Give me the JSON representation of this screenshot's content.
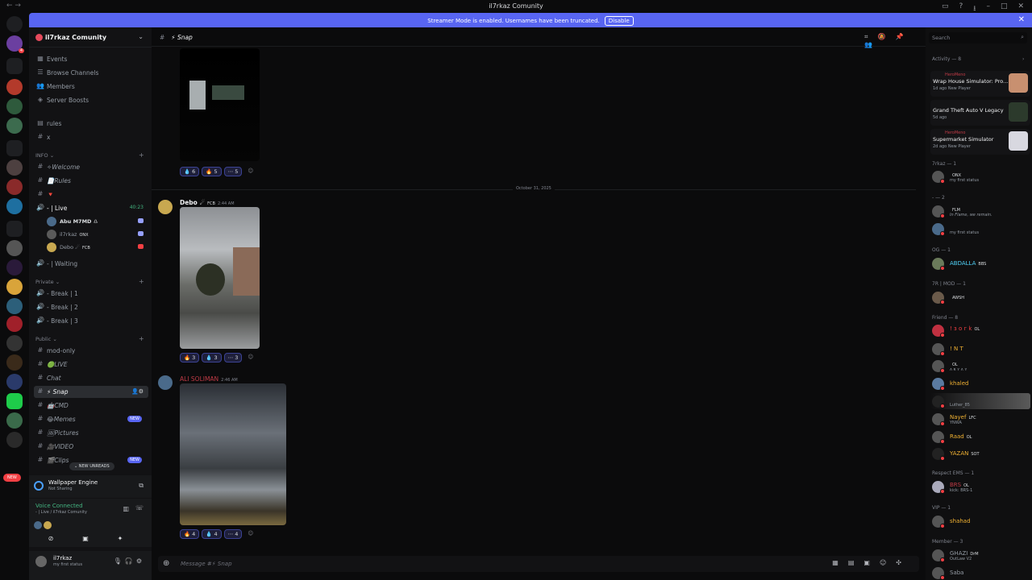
{
  "window": {
    "title": "il7rkaz Comunity"
  },
  "banner": {
    "text": "Streamer Mode is enabled. Usernames have been truncated.",
    "button": "Disable"
  },
  "server": {
    "name": "il7rkaz Comunity"
  },
  "nav": [
    {
      "label": "Events",
      "icon": "calendar-icon"
    },
    {
      "label": "Browse Channels",
      "icon": "browse-channels-icon"
    },
    {
      "label": "Members",
      "icon": "members-icon"
    },
    {
      "label": "Server Boosts",
      "icon": "boost-icon"
    }
  ],
  "top_channels": [
    "rules",
    "x"
  ],
  "categories": {
    "info": "INFO",
    "private": "Private",
    "public": "Public"
  },
  "info_channels": [
    "✧Welcome",
    "📄Rules",
    "🔻"
  ],
  "live_channel": {
    "label": "- | Live",
    "timer": "40:23"
  },
  "voice_users": [
    {
      "name": "Abu M7MD ♎",
      "tag": ""
    },
    {
      "name": "il7rkaz",
      "tag": "ONX"
    },
    {
      "name": "Debo ☄",
      "tag": "FCB"
    }
  ],
  "waiting_channel": "- | Waiting",
  "private_channels": [
    "- Break | 1",
    "- Break | 2",
    "- Break | 3"
  ],
  "public_channels": [
    {
      "label": "mod-only",
      "new": ""
    },
    {
      "label": "🟢LIVE",
      "new": ""
    },
    {
      "label": "Chat",
      "new": ""
    },
    {
      "label": "⚡ Snap",
      "new": ""
    },
    {
      "label": "🤖CMD",
      "new": ""
    },
    {
      "label": "😂Memes",
      "new": "NEW"
    },
    {
      "label": "🖼Pictures",
      "new": ""
    },
    {
      "label": "🎥VIDEO",
      "new": ""
    },
    {
      "label": "🎬Clips",
      "new": "NEW"
    }
  ],
  "new_unreads": "NEW UNREADS",
  "new_badge": "NEW",
  "wallpaper": {
    "title": "Wallpaper Engine",
    "status": "Not Sharing"
  },
  "voice": {
    "status": "Voice Connected",
    "channel": "- | Live / il7rkaz Comunity"
  },
  "user": {
    "name": "il7rkaz",
    "status": "my first status"
  },
  "chat": {
    "channel": "⚡ Snap",
    "date_divider": "October 31, 2025",
    "messages": [
      {
        "author": "",
        "badge": "",
        "time": "",
        "reactions": [
          "6",
          "5",
          "5"
        ]
      },
      {
        "author": "Debo ☄",
        "badge": "FCB",
        "time": "2:44 AM",
        "reactions": [
          "3",
          "3",
          "3"
        ]
      },
      {
        "author": "ALI SOLIMAN",
        "badge": "",
        "time": "2:46 AM",
        "reactions": [
          "4",
          "4",
          "4"
        ]
      }
    ],
    "composer_placeholder": "Message #⚡ Snap"
  },
  "search_placeholder": "Search",
  "activity": {
    "header": "Activity — 8",
    "items": [
      {
        "user": "HeroMeno",
        "game": "Wrap House Simulator: Pro...",
        "meta": "1d ago  New Player"
      },
      {
        "user": "",
        "game": "Grand Theft Auto V Legacy",
        "meta": "5d ago"
      },
      {
        "user": "HeroMeno",
        "game": "Supermarket Simulator",
        "meta": "2d ago  New Player"
      }
    ]
  },
  "member_groups": [
    {
      "header": "7rkaz — 1",
      "members": [
        {
          "name": "",
          "tag": "ONX",
          "status": "my first status",
          "color": "#dbdee1"
        }
      ]
    },
    {
      "header": "- — 2",
      "members": [
        {
          "name": "",
          "tag": "FLM",
          "status": "In Flame, we remain.",
          "color": "#c03b46"
        },
        {
          "name": "",
          "tag": "",
          "status": "my first status",
          "color": "#c03b46"
        }
      ]
    },
    {
      "header": "OG — 1",
      "members": [
        {
          "name": "ABDALLA",
          "tag": "BBS",
          "status": "",
          "color": "#4fd1f7"
        }
      ]
    },
    {
      "header": "7R | MOD — 1",
      "members": [
        {
          "name": "",
          "tag": "AWSH",
          "status": "",
          "color": "#555"
        }
      ]
    },
    {
      "header": "Friend — 8",
      "members": [
        {
          "name": "! з о г k",
          "tag": "OL",
          "status": "",
          "color": "#f23f43"
        },
        {
          "name": "! N T",
          "tag": "",
          "status": "",
          "color": "#f0b132"
        },
        {
          "name": "",
          "tag": "OL",
          "status": "ʌ ʀ ʏ ʌ ʏ",
          "color": "#f0b132"
        },
        {
          "name": "khaled",
          "tag": "",
          "status": "",
          "color": "#f0b132"
        },
        {
          "name": "",
          "tag": "",
          "status": "Luther_85",
          "color": "#949ba4"
        },
        {
          "name": "Nayef",
          "tag": "LFC",
          "status": "YNWA",
          "color": "#f0b132"
        },
        {
          "name": "Raad",
          "tag": "OL",
          "status": "",
          "color": "#f0b132"
        },
        {
          "name": "YAZAN",
          "tag": "SOT",
          "status": "",
          "color": "#f0b132"
        }
      ]
    },
    {
      "header": "Respect EMS — 1",
      "members": [
        {
          "name": "BRS",
          "tag": "OL",
          "status": "kick: BRS-1",
          "color": "#c03b46"
        }
      ]
    },
    {
      "header": "VIP — 1",
      "members": [
        {
          "name": "shahad",
          "tag": "",
          "status": "",
          "color": "#f0b132"
        }
      ]
    },
    {
      "header": "Member — 3",
      "members": [
        {
          "name": "GHAZI",
          "tag": "DrM",
          "status": "OutLaw V2",
          "color": "#949ba4"
        },
        {
          "name": "Saba",
          "tag": "",
          "status": "",
          "color": "#949ba4"
        }
      ]
    }
  ]
}
